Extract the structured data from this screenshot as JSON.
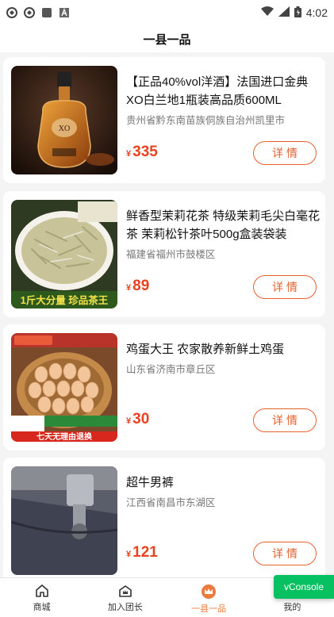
{
  "status_bar": {
    "time": "4:02",
    "left_icons": [
      "app-notification-icon",
      "app-notification-icon",
      "square-icon",
      "a-icon"
    ],
    "right_icons": [
      "wifi-icon",
      "signal-icon",
      "battery-icon"
    ]
  },
  "header": {
    "title": "一县一品"
  },
  "products": [
    {
      "title": "【正品40%vol洋酒】法国进口金典XO白兰地1瓶装高品质600ML",
      "address": "贵州省黔东南苗族侗族自治州凯里市",
      "currency": "¥",
      "price": "335",
      "button": "详情",
      "image": "cognac-bottle-image"
    },
    {
      "title": "鲜香型茉莉花茶 特级茉莉毛尖白毫花茶 茉莉松针茶叶500g盒装袋装",
      "address": "福建省福州市鼓楼区",
      "currency": "¥",
      "price": "89",
      "button": "详情",
      "image": "jasmine-tea-image",
      "image_caption": "1斤大分量 珍品茶王"
    },
    {
      "title": "鸡蛋大王 农家散养新鲜土鸡蛋",
      "address": "山东省济南市章丘区",
      "currency": "¥",
      "price": "30",
      "button": "详情",
      "image": "eggs-basket-image",
      "image_caption": "七天无理由退换"
    },
    {
      "title": "超牛男裤",
      "address": "江西省南昌市东湖区",
      "currency": "¥",
      "price": "121",
      "button": "详情",
      "image": "trousers-machine-image"
    }
  ],
  "tabbar": {
    "items": [
      {
        "label": "商城",
        "icon": "home-icon"
      },
      {
        "label": "加入团长",
        "icon": "crown-house-icon"
      },
      {
        "label": "一县一品",
        "icon": "crown-badge-icon",
        "active": true
      },
      {
        "label": "我的",
        "icon": "user-icon"
      }
    ]
  },
  "vconsole": {
    "label": "vConsole"
  },
  "colors": {
    "accent": "#e8602c",
    "price": "#e8431e",
    "vconsole": "#07c160"
  }
}
